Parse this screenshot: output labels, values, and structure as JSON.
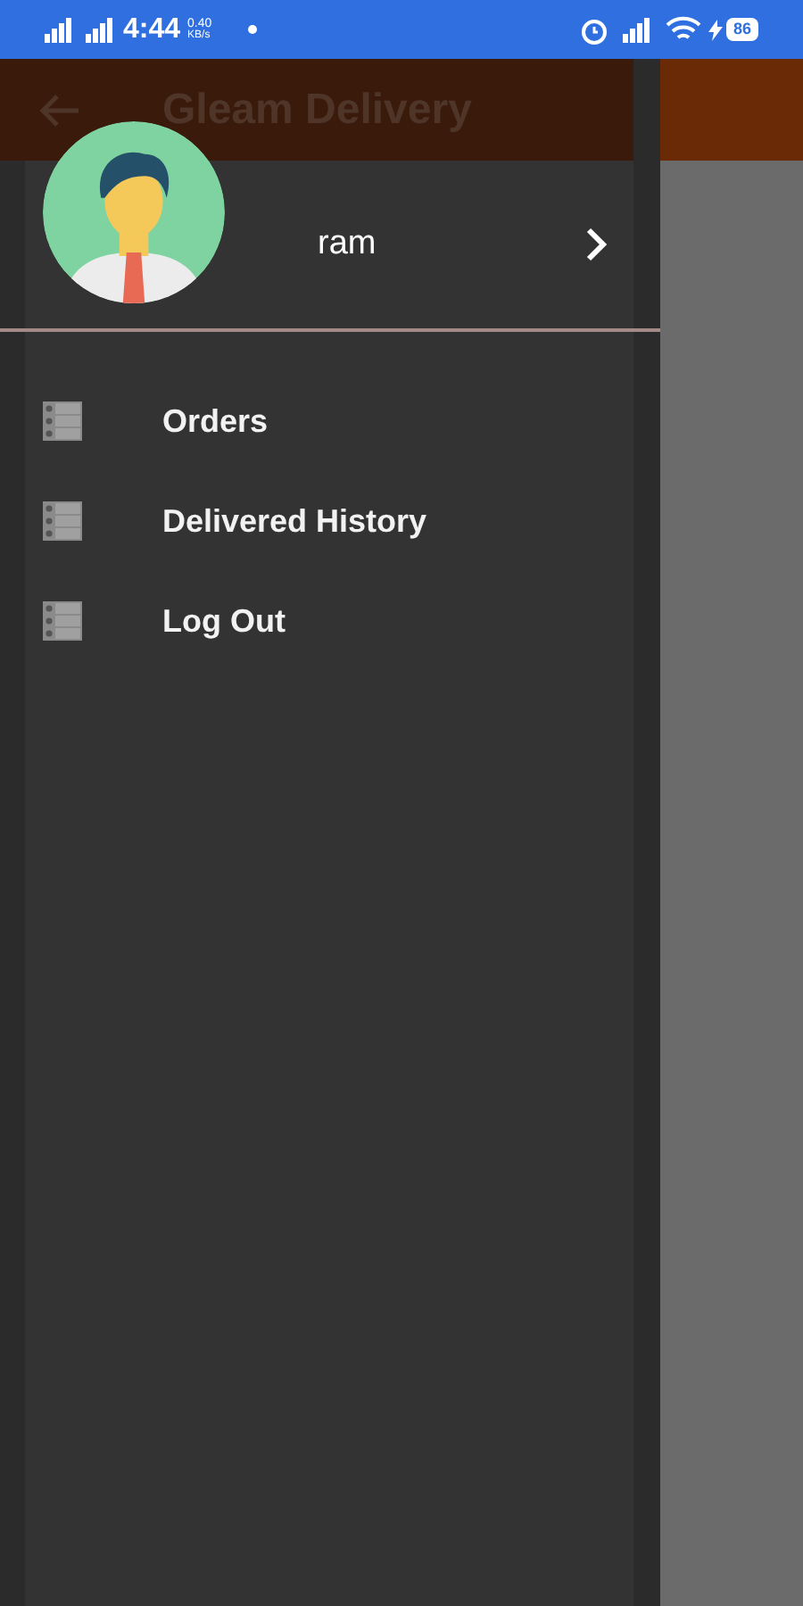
{
  "status_bar": {
    "time": "4:44",
    "net_speed": "0.40",
    "net_unit": "KB/s",
    "battery": "86"
  },
  "app_bar": {
    "title": "Gleam Delivery"
  },
  "drawer": {
    "user": {
      "name": "ram"
    },
    "items": [
      {
        "label": "Orders"
      },
      {
        "label": "Delivered History"
      },
      {
        "label": "Log Out"
      }
    ]
  }
}
